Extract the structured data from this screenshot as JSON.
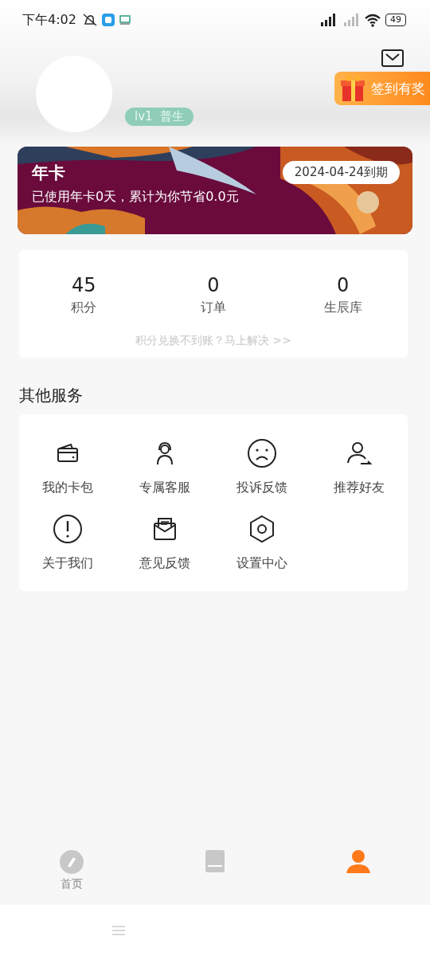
{
  "status_bar": {
    "time": "下午4:02",
    "battery": "49"
  },
  "profile": {
    "level": "lv1",
    "level_name": "普生",
    "checkin": "签到有奖"
  },
  "card": {
    "title": "年卡",
    "expiry": "2024-04-24到期",
    "summary": "已使用年卡0天，累计为你节省0.0元"
  },
  "stats": [
    {
      "value": "45",
      "label": "积分"
    },
    {
      "value": "0",
      "label": "订单"
    },
    {
      "value": "0",
      "label": "生辰库"
    }
  ],
  "stats_hint": "积分兑换不到账？马上解决 >>",
  "services_title": "其他服务",
  "services": [
    {
      "kind": "wallet",
      "label": "我的卡包"
    },
    {
      "kind": "agent",
      "label": "专属客服"
    },
    {
      "kind": "sad",
      "label": "投诉反馈"
    },
    {
      "kind": "share",
      "label": "推荐好友"
    },
    {
      "kind": "info",
      "label": "关于我们"
    },
    {
      "kind": "mail",
      "label": "意见反馈"
    },
    {
      "kind": "settings",
      "label": "设置中心"
    }
  ],
  "tabs": [
    {
      "kind": "home",
      "label": "首页",
      "selected": false
    },
    {
      "kind": "book",
      "selected": false
    },
    {
      "kind": "person",
      "selected": true
    }
  ]
}
